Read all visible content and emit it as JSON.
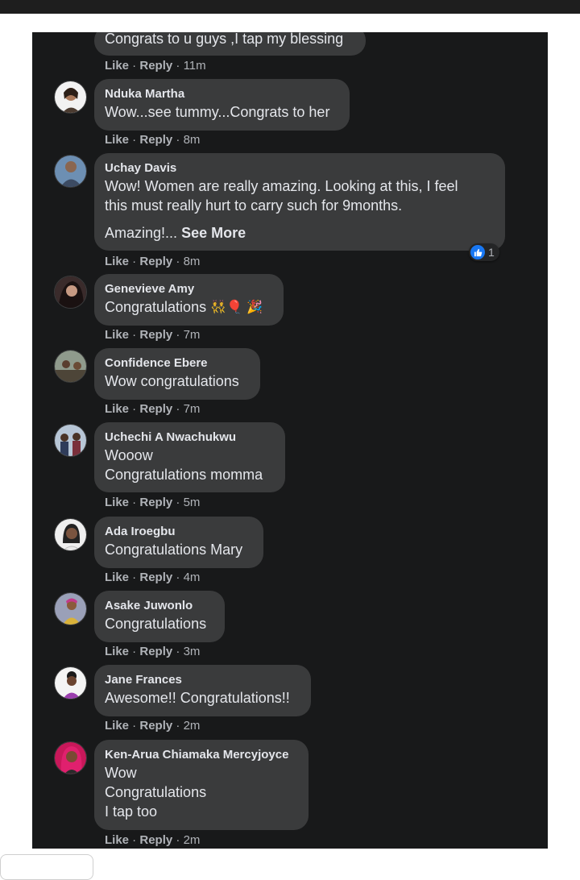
{
  "meta_labels": {
    "like": "Like",
    "sep": " · ",
    "reply": "Reply"
  },
  "comments": [
    {
      "author": "",
      "lines": [
        "Congrats to u guys ,I tap my blessing"
      ],
      "time": "11m"
    },
    {
      "author": "Nduka Martha",
      "lines": [
        "Wow...see tummy...Congrats to her"
      ],
      "time": "8m"
    },
    {
      "author": "Uchay Davis",
      "lines": [
        "Wow! Women are really amazing. Looking at this, I feel",
        "this must really hurt to carry such for 9months.",
        "Amazing!..."
      ],
      "see_more": "See More",
      "time": "8m",
      "reaction_count": "1"
    },
    {
      "author": "Genevieve Amy",
      "lines": [
        "Congratulations"
      ],
      "emojis": [
        "👯",
        "🎈",
        "🎉"
      ],
      "time": "7m"
    },
    {
      "author": "Confidence Ebere",
      "lines": [
        "Wow congratulations"
      ],
      "time": "7m"
    },
    {
      "author": "Uchechi A Nwachukwu",
      "lines": [
        "Wooow",
        "Congratulations momma"
      ],
      "time": "5m"
    },
    {
      "author": "Ada Iroegbu",
      "lines": [
        "Congratulations Mary"
      ],
      "time": "4m"
    },
    {
      "author": "Asake Juwonlo",
      "lines": [
        "Congratulations"
      ],
      "time": "3m"
    },
    {
      "author": "Jane Frances",
      "lines": [
        "Awesome!! Congratulations!!"
      ],
      "time": "2m"
    },
    {
      "author": "Ken-Arua Chiamaka Mercyjoyce",
      "lines": [
        "Wow",
        "Congratulations",
        "I tap too"
      ],
      "time": "2m"
    }
  ],
  "colors": {
    "panel": "#18191a",
    "bubble": "#3a3b3c",
    "text": "#e4e6eb",
    "muted": "#b0b3b8",
    "like_blue": "#1877f2"
  }
}
